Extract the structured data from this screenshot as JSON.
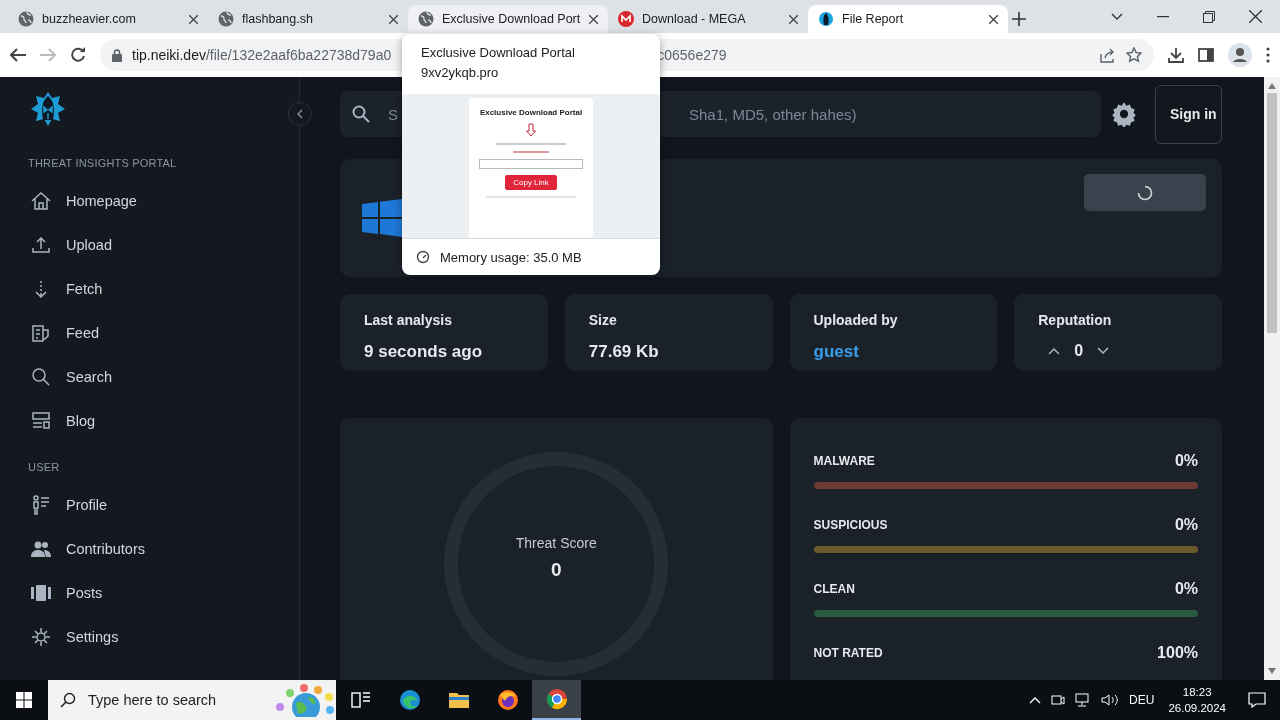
{
  "browser": {
    "tabs": [
      {
        "title": "buzzheavier.com",
        "selected": false
      },
      {
        "title": "flashbang.sh",
        "selected": false
      },
      {
        "title": "Exclusive Download Port",
        "selected": false
      },
      {
        "title": "Download - MEGA",
        "selected": false
      },
      {
        "title": "File Report",
        "selected": true
      }
    ],
    "url_host": "tip.neiki.dev",
    "url_path_start": "/file/132e2aaf6ba22738d79a0",
    "url_path_end": "c0656e279"
  },
  "tab_preview": {
    "title": "Exclusive Download Portal",
    "domain": "9xv2ykqb.pro",
    "thumbnail": {
      "heading": "Exclusive Download Portal",
      "button": "Copy Link"
    },
    "memory": "Memory usage: 35.0 MB"
  },
  "sidebar": {
    "sections": [
      {
        "label": "THREAT INSIGHTS PORTAL",
        "items": [
          {
            "label": "Homepage"
          },
          {
            "label": "Upload"
          },
          {
            "label": "Fetch"
          },
          {
            "label": "Feed"
          },
          {
            "label": "Search"
          },
          {
            "label": "Blog"
          }
        ]
      },
      {
        "label": "USER",
        "items": [
          {
            "label": "Profile"
          },
          {
            "label": "Contributors"
          },
          {
            "label": "Posts"
          },
          {
            "label": "Settings"
          }
        ]
      }
    ]
  },
  "search": {
    "placeholder_start": "S",
    "placeholder_end": "Sha1, MD5, other hahes)"
  },
  "sign_in": "Sign in",
  "stats": [
    {
      "label": "Last analysis",
      "value": "9 seconds ago",
      "kind": "text"
    },
    {
      "label": "Size",
      "value": "77.69 Kb",
      "kind": "text"
    },
    {
      "label": "Uploaded by",
      "value": "guest",
      "kind": "link"
    },
    {
      "label": "Reputation",
      "value": "0",
      "kind": "vote"
    }
  ],
  "threat_score": {
    "label": "Threat Score",
    "value": "0"
  },
  "verdicts": [
    {
      "label": "MALWARE",
      "reading": "0%",
      "level": 0,
      "color": "#6b3a32"
    },
    {
      "label": "SUSPICIOUS",
      "reading": "0%",
      "level": 0,
      "color": "#6b5a2b"
    },
    {
      "label": "CLEAN",
      "reading": "0%",
      "level": 0,
      "color": "#275a3f"
    },
    {
      "label": "NOT RATED",
      "reading": "100%"
    }
  ],
  "taskbar": {
    "search_placeholder": "Type here to search",
    "apps": [
      {
        "selected": false
      },
      {
        "selected": false
      },
      {
        "selected": false
      },
      {
        "selected": false
      },
      {
        "selected": true
      }
    ],
    "language": "DEU",
    "time": "18:23",
    "date": "26.09.2024"
  }
}
